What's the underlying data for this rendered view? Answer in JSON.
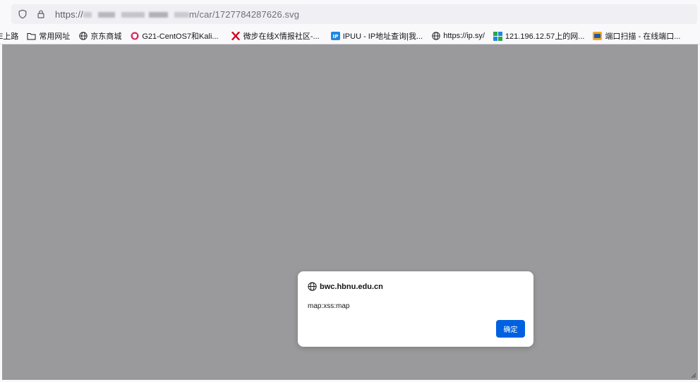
{
  "urlbar": {
    "url_visible_prefix": "https://",
    "url_visible_suffix": "m/car/1727784287626.svg",
    "shield_icon": "shield-icon",
    "lock_icon": "lock-icon"
  },
  "bookmarks": [
    {
      "label": "E上路",
      "icon": "none"
    },
    {
      "label": "常用网址",
      "icon": "folder-icon"
    },
    {
      "label": "京东商城",
      "icon": "globe-icon"
    },
    {
      "label": "G21-CentOS7和Kali...",
      "icon": "shield-badge-icon"
    },
    {
      "label": "微步在线X情报社区-...",
      "icon": "x-logo-icon"
    },
    {
      "label": "IPUU - IP地址查询|我...",
      "icon": "ip-logo-icon"
    },
    {
      "label": "https://ip.sy/",
      "icon": "globe-icon"
    },
    {
      "label": "121.196.12.57上的网...",
      "icon": "network-icon"
    },
    {
      "label": "端口扫描 - 在线端口...",
      "icon": "port-scan-icon"
    }
  ],
  "dialog": {
    "origin": "bwc.hbnu.edu.cn",
    "message": "map:xss:map",
    "ok_label": "确定"
  },
  "colors": {
    "overlay": "#9a9a9c",
    "ok_button": "#0061e0",
    "urlbar_bg": "#f0f0f4"
  }
}
